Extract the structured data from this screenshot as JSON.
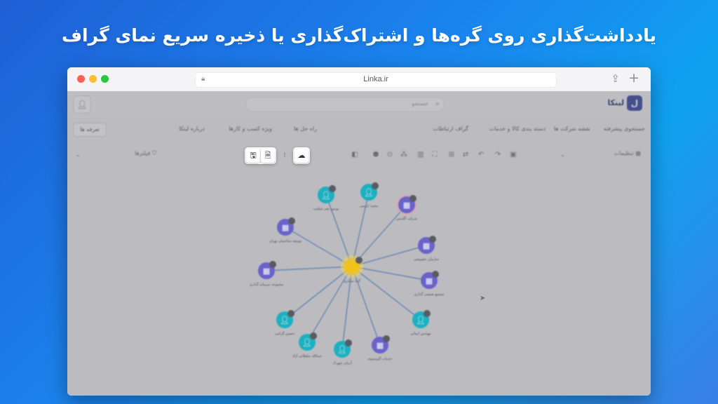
{
  "hero": {
    "title": "یادداشت‌گذاری روی گره‌ها و اشتراک‌گذاری یا ذخیره سریع نمای گراف"
  },
  "browser": {
    "url": "Linka.ir"
  },
  "app": {
    "logo_text": "لینکا",
    "logo_mark": "ل",
    "search_placeholder": "جستجو",
    "menu": [
      "جستجوی پیشرفته",
      "نقشه شرکت ها",
      "دسته بندی کالا و خدمات",
      "گراف ارتباطات",
      "راه حل ها",
      "ویژه کسب و کارها",
      "درباره لینکا"
    ],
    "pricing": "تعرفه ها",
    "toolbar_right_label": "تنظیمات",
    "toolbar_left_label": "فیلترها",
    "center_node": {
      "label": "گره مرکزی",
      "color": "#f2c21c"
    },
    "nodes": [
      {
        "label": "محمد کریمی",
        "kind": "person",
        "color": "#1cb0c0"
      },
      {
        "label": "شرکت گلدیس",
        "kind": "company",
        "color": "#6a63c9"
      },
      {
        "label": "سازمان خصوصی",
        "kind": "company",
        "color": "#6a63c9"
      },
      {
        "label": "مجتمع صنعتی گذاری",
        "kind": "company",
        "color": "#6a63c9"
      },
      {
        "label": "مهندس ایمانی",
        "kind": "person",
        "color": "#1cb0c0"
      },
      {
        "label": "خدمات آلومینیوم",
        "kind": "company",
        "color": "#6a63c9"
      },
      {
        "label": "آرمان شهرک",
        "kind": "person",
        "color": "#1cb0c0"
      },
      {
        "label": "عبدالله سلطانی آزاد",
        "kind": "person",
        "color": "#1cb0c0"
      },
      {
        "label": "حسین گرامی",
        "kind": "person",
        "color": "#1cb0c0"
      },
      {
        "label": "مجموعه سرمایه گذاری",
        "kind": "company",
        "color": "#6a63c9"
      },
      {
        "label": "توسعه ساختمان تهران",
        "kind": "company",
        "color": "#6a63c9"
      },
      {
        "label": "یونس تقی شکیب",
        "kind": "person",
        "color": "#1cb0c0"
      }
    ]
  }
}
